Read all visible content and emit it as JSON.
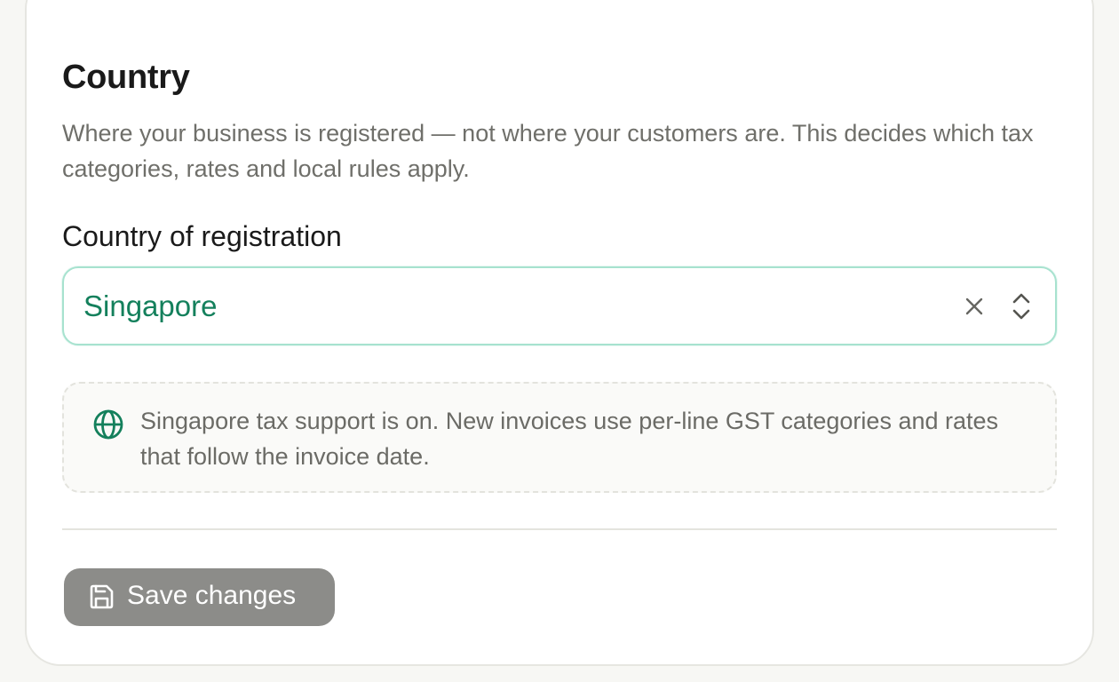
{
  "section": {
    "title": "Country",
    "description": "Where your business is registered — not where your customers are. This decides which tax categories, rates and local rules apply."
  },
  "country_field": {
    "label": "Country of registration",
    "value": "Singapore"
  },
  "info": {
    "icon": "globe-icon",
    "text": "Singapore tax support is on. New invoices use per-line GST categories and rates that follow the invoice date."
  },
  "actions": {
    "save_label": "Save changes",
    "save_icon": "floppy-disk-icon"
  },
  "colors": {
    "accent": "#14805c",
    "select_border": "#a7e2cf",
    "button_bg": "#8c8c89"
  }
}
